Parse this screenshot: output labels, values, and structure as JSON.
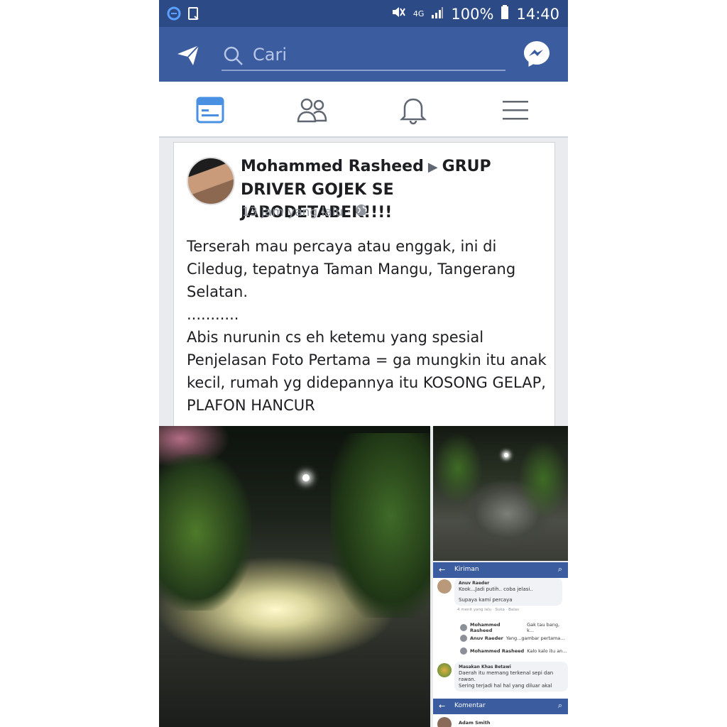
{
  "status_bar": {
    "network": "4G",
    "battery": "100%",
    "time": "14:40"
  },
  "fb_header": {
    "search_placeholder": "Cari"
  },
  "post": {
    "author": "Mohammed Rasheed",
    "arrow": "▶",
    "group": "GRUP DRIVER GOJEK SE JABODETABEK!!!!",
    "time": "13 jam yang lalu ·",
    "body_lines": [
      "Terserah mau percaya atau enggak, ini di Ciledug, tepatnya Taman Mangu, Tangerang Selatan.",
      "...........",
      "Abis nurunin cs eh ketemu yang spesial",
      "Penjelasan Foto Pertama = ga mungkin itu anak kecil, rumah yg didepannya itu KOSONG GELAP, PLAFON HANCUR"
    ]
  },
  "comments_screenshot": {
    "top_bar_title": "Kiriman",
    "bottom_bar_title": "Komentar",
    "comment1_name": "Anuv Raeder",
    "comment1_text": "Kook...Jadi putih.. coba jelasi..",
    "comment1_text2": "Supaya kami percaya",
    "comment1_meta": "4 menit yang lalu · Suka · Balas",
    "replies": [
      {
        "name": "Mohammed Rasheed",
        "text": "Gak tau bang, k..."
      },
      {
        "name": "Anuv Raeder",
        "text": "Yang...gambar pertama..."
      },
      {
        "name": "Mohammed Rasheed",
        "text": "Kalo kalo itu an..."
      }
    ],
    "comment2_name": "Masakan Khas Betawi",
    "comment2_lines": [
      "Daerah itu memang terkenal sepi dan",
      "rawan.",
      "Sering terjadi hal hal yang diluar akal"
    ],
    "bottom_name": "Adam Smith"
  },
  "colors": {
    "status_bar": "#2c4a86",
    "fb_blue": "#3b5c9f",
    "tab_active": "#4a90e2"
  }
}
